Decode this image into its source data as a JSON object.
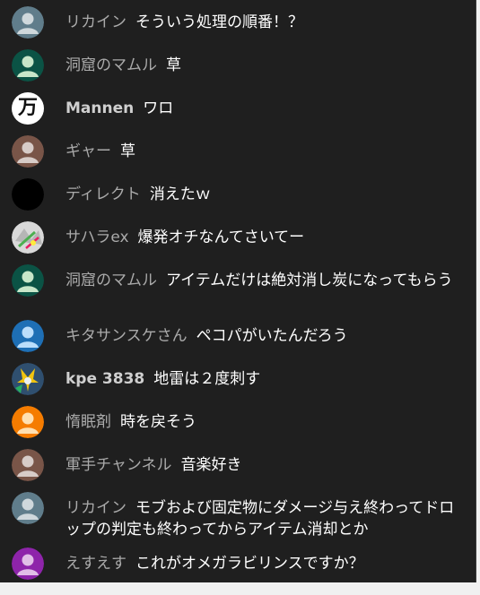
{
  "chat": {
    "messages": [
      {
        "author": "リカイン",
        "text": "そういう処理の順番！？",
        "avatar_color": "#607d8b"
      },
      {
        "author": "洞窟のマムル",
        "text": "草",
        "avatar_color": "#0b5345"
      },
      {
        "author": "Mannen",
        "text": "ワロ",
        "avatar_color": "#ffffff",
        "avatar_glyph": "万"
      },
      {
        "author": "ギャー",
        "text": "草",
        "avatar_color": "#795548"
      },
      {
        "author": "ディレクト",
        "text": "消えたｗ",
        "avatar_color": "#000000"
      },
      {
        "author": "サハラex",
        "text": "爆発オチなんてさいてー",
        "avatar_color": "#d0d0d0"
      },
      {
        "author": "洞窟のマムル",
        "text": "アイテムだけは絶対消し炭になってもらう",
        "avatar_color": "#0b5345"
      },
      {
        "author": "キタサンスケさん",
        "text": "ペコパがいたんだろう",
        "avatar_color": "#1e6fb5"
      },
      {
        "author": "kpe 3838",
        "text": "地雷は２度刺す",
        "avatar_color": "#3a5a7a"
      },
      {
        "author": "惰眠剤",
        "text": "時を戻そう",
        "avatar_color": "#f57c00"
      },
      {
        "author": "軍手チャンネル",
        "text": "音楽好き",
        "avatar_color": "#795548"
      },
      {
        "author": "リカイン",
        "text": "モブおよび固定物にダメージ与え終わってドロップの判定も終わってからアイテム消却とか",
        "avatar_color": "#607d8b"
      },
      {
        "author": "えすえす",
        "text": "これがオメガラビリンスですか？",
        "avatar_color": "#8e24aa"
      }
    ]
  }
}
